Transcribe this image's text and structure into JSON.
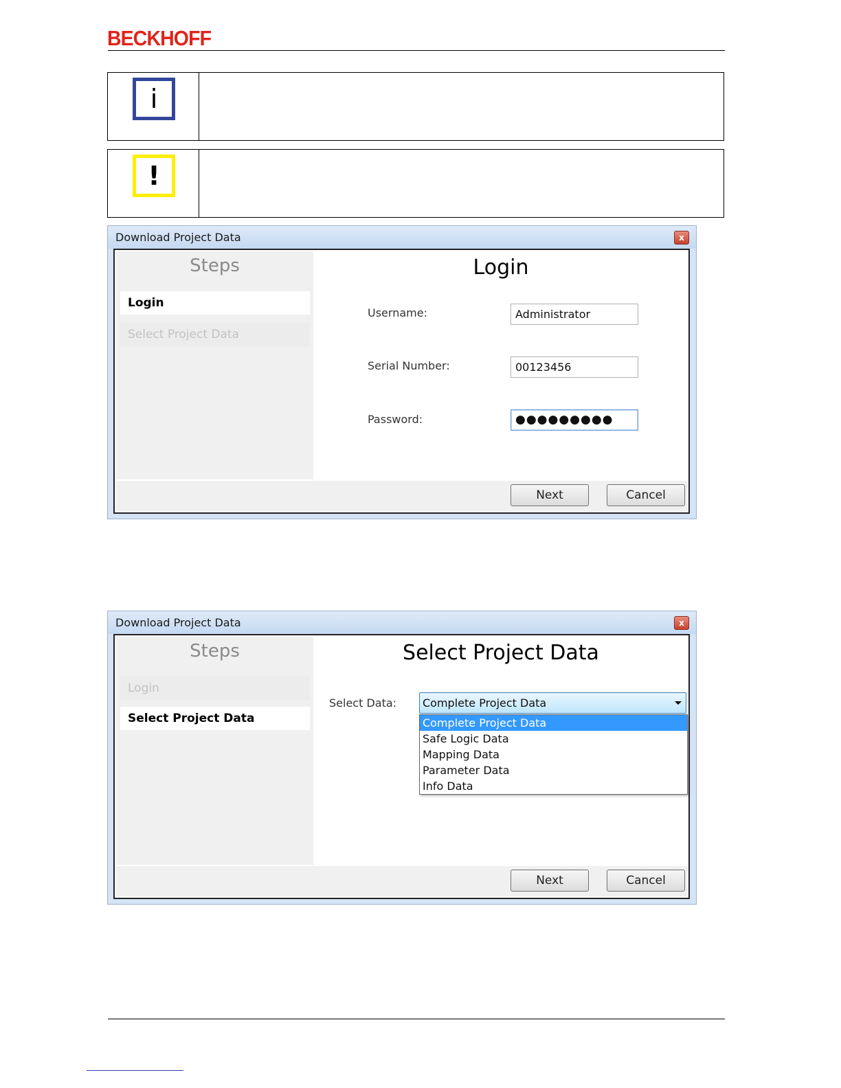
{
  "header": {
    "logo": "BECKHOFF"
  },
  "notes": [
    {
      "icon": "info-icon",
      "glyph": "i",
      "color": "#33479a"
    },
    {
      "icon": "warning-icon",
      "glyph": "!",
      "color": "#ffee00"
    }
  ],
  "dialog1": {
    "title": "Download Project Data",
    "close": "x",
    "steps_header": "Steps",
    "steps": [
      "Login",
      "Select Project Data"
    ],
    "heading": "Login",
    "fields": {
      "username_label": "Username:",
      "username_value": "Administrator",
      "serial_label": "Serial Number:",
      "serial_value": "00123456",
      "password_label": "Password:",
      "password_value": "●●●●●●●●●"
    },
    "next": "Next",
    "cancel": "Cancel"
  },
  "dialog2": {
    "title": "Download Project Data",
    "close": "x",
    "steps_header": "Steps",
    "steps": [
      "Login",
      "Select Project Data"
    ],
    "heading": "Select Project Data",
    "select_label": "Select Data:",
    "selected": "Complete Project Data",
    "options": [
      "Complete Project Data",
      "Safe Logic Data",
      "Mapping Data",
      "Parameter Data",
      "Info Data"
    ],
    "next": "Next",
    "cancel": "Cancel"
  },
  "colors": {
    "brand": "#e0241b",
    "selection": "#3399ff"
  }
}
